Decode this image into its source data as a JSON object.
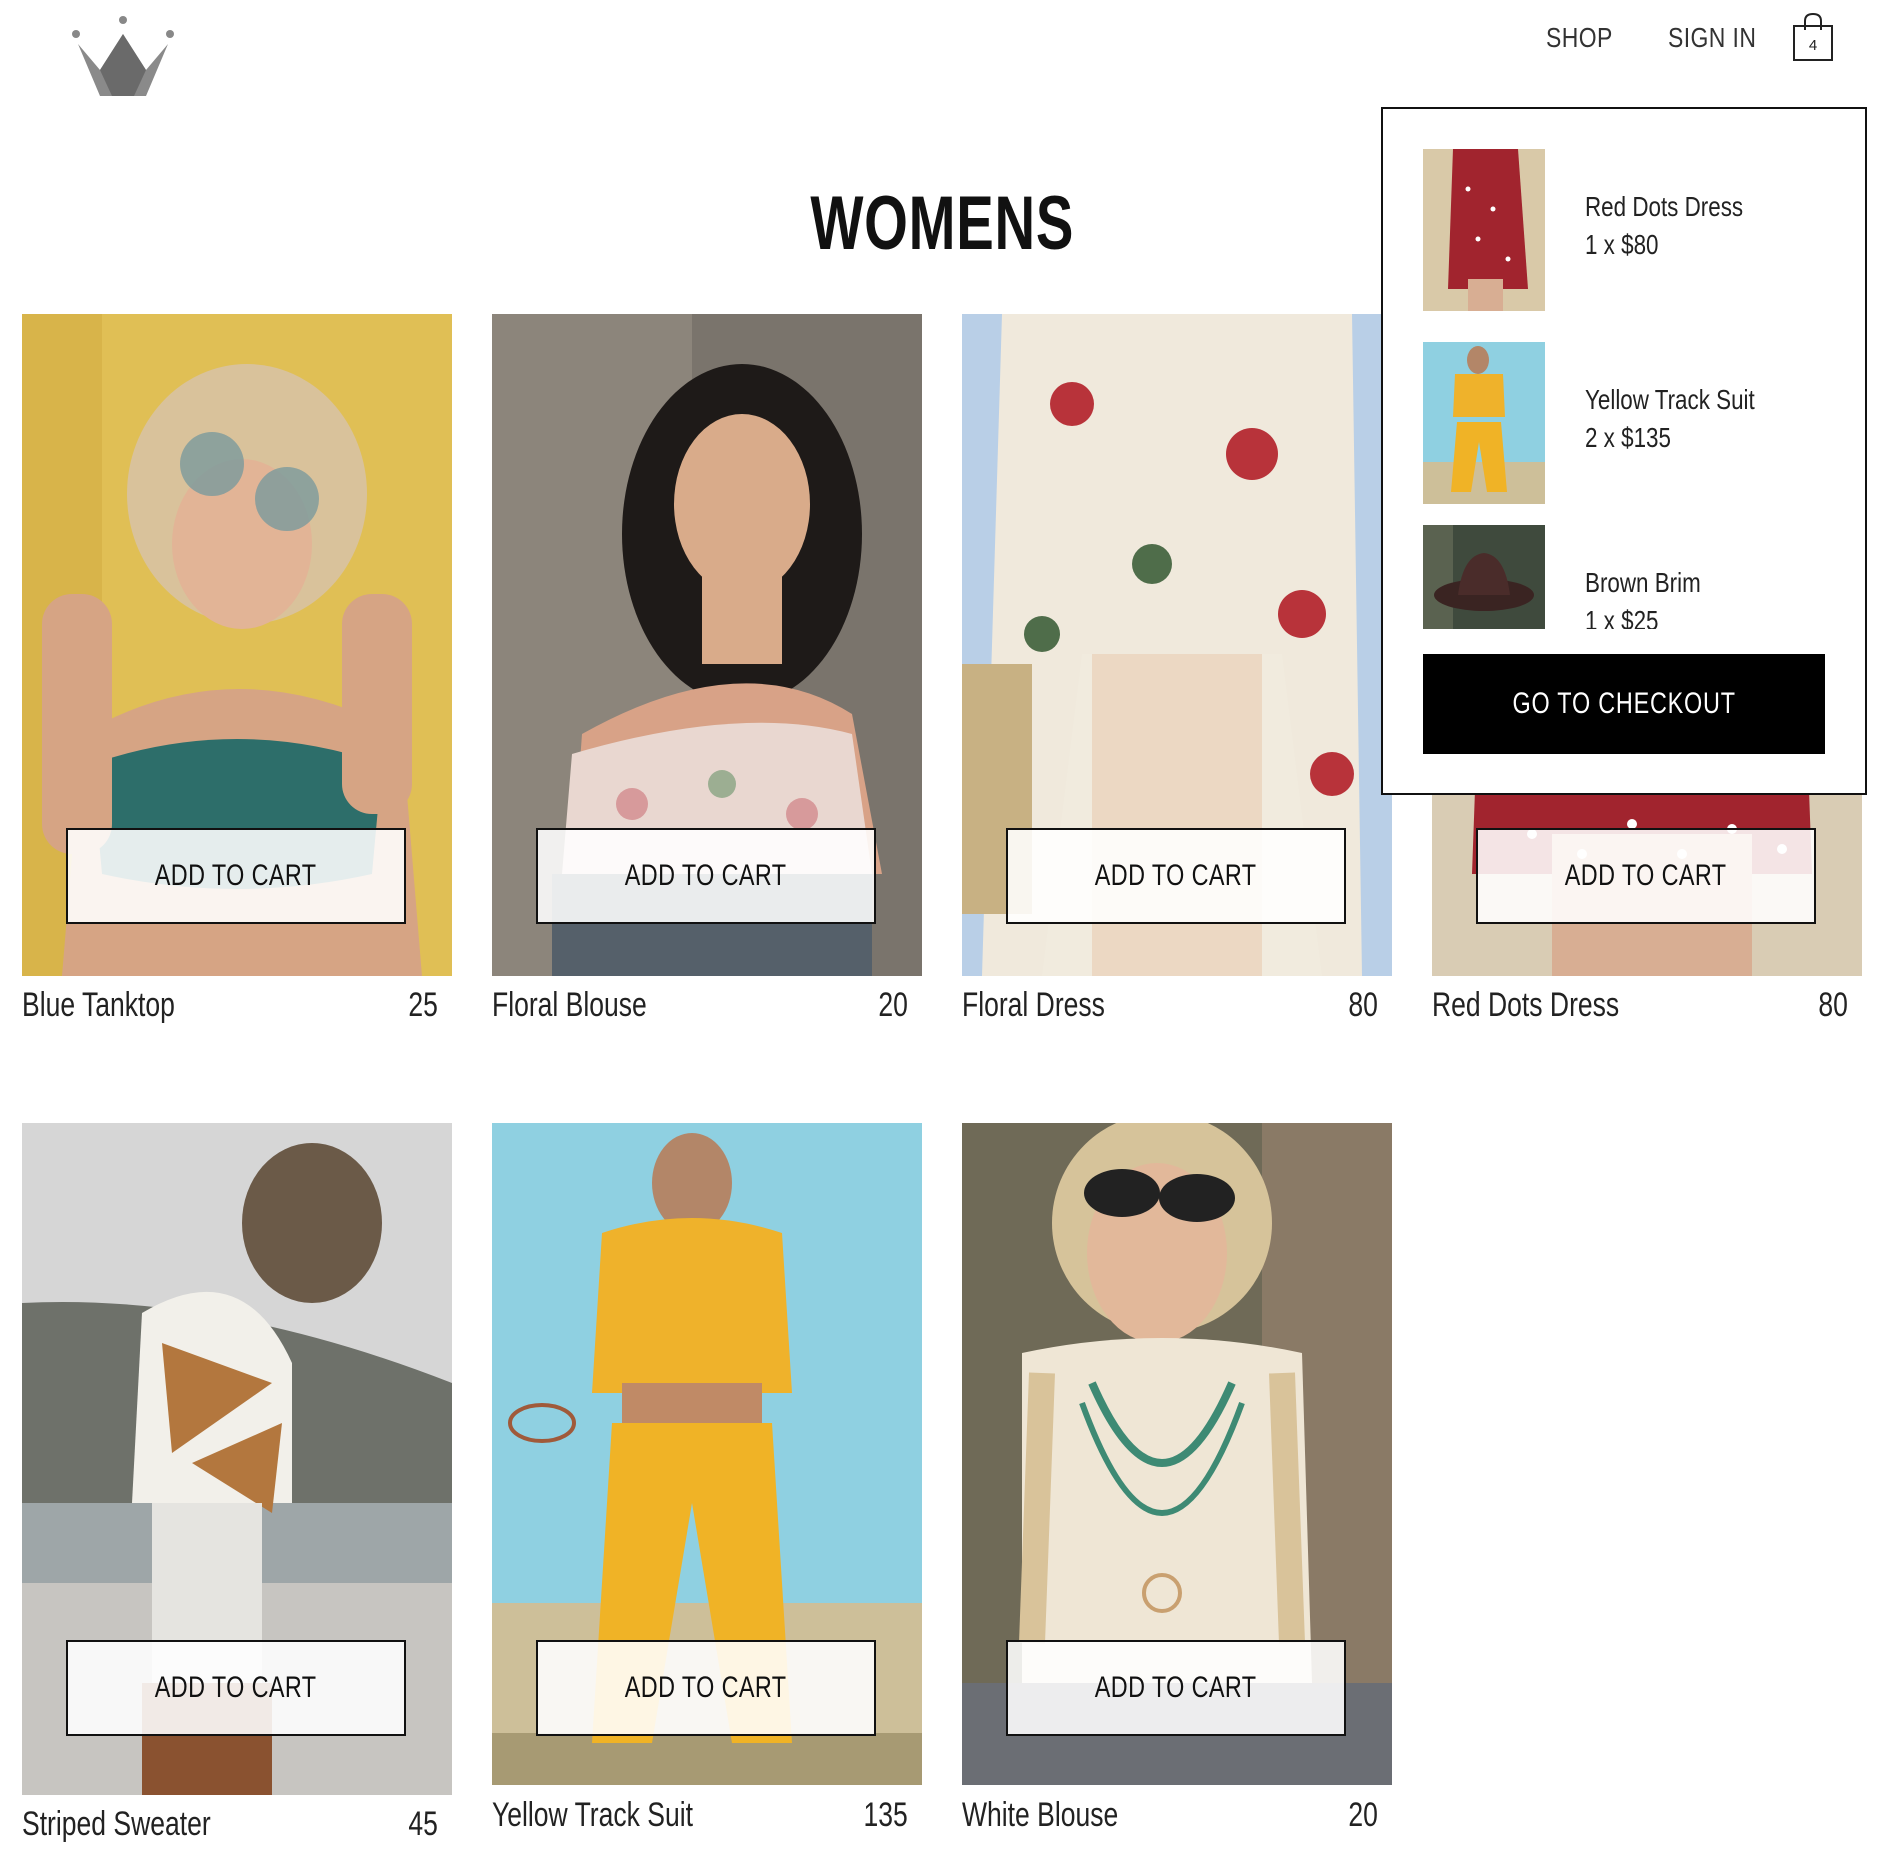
{
  "header": {
    "logo_icon": "crown-logo-icon",
    "nav": {
      "shop": "SHOP",
      "sign_in": "SIGN IN"
    },
    "cart": {
      "icon": "shopping-bag-icon",
      "count": "4"
    }
  },
  "page": {
    "title": "WOMENS"
  },
  "products": [
    {
      "name": "Blue Tanktop",
      "price": "25",
      "button": "ADD TO CART"
    },
    {
      "name": "Floral Blouse",
      "price": "20",
      "button": "ADD TO CART"
    },
    {
      "name": "Floral Dress",
      "price": "80",
      "button": "ADD TO CART"
    },
    {
      "name": "Red Dots Dress",
      "price": "80",
      "button": "ADD TO CART"
    },
    {
      "name": "Striped Sweater",
      "price": "45",
      "button": "ADD TO CART"
    },
    {
      "name": "Yellow Track Suit",
      "price": "135",
      "button": "ADD TO CART"
    },
    {
      "name": "White Blouse",
      "price": "20",
      "button": "ADD TO CART"
    }
  ],
  "cart_dropdown": {
    "items": [
      {
        "name": "Red Dots Dress",
        "qty": "1 x $80"
      },
      {
        "name": "Yellow Track Suit",
        "qty": "2 x $135"
      },
      {
        "name": "Brown Brim",
        "qty": "1 x $25"
      }
    ],
    "checkout": "GO TO CHECKOUT"
  }
}
